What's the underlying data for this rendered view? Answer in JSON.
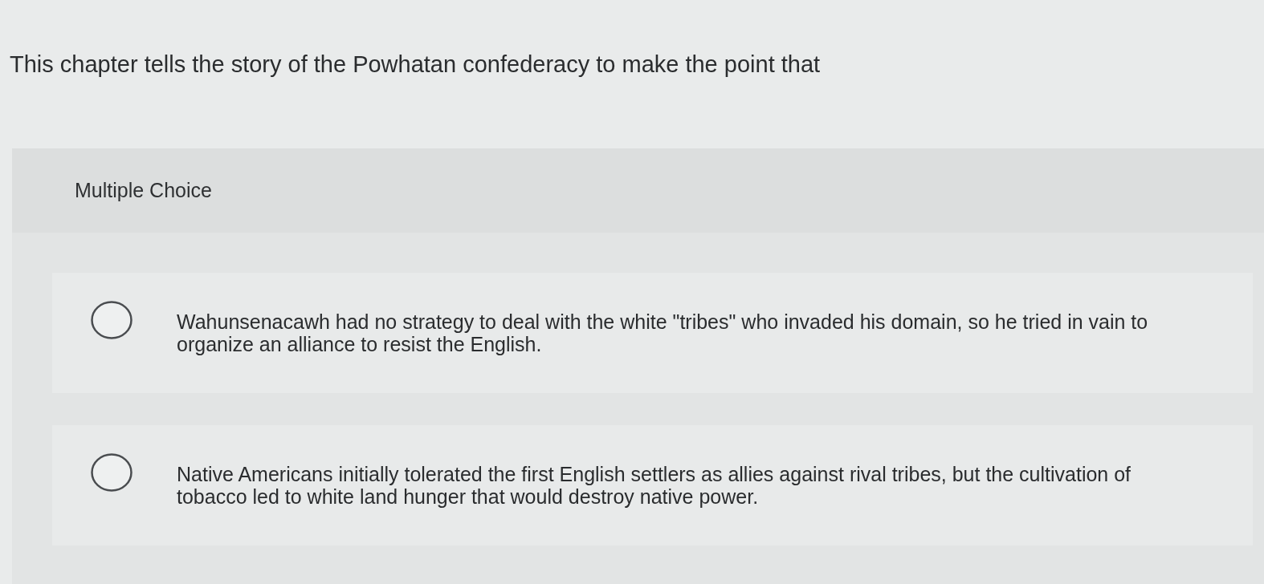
{
  "question": {
    "text": "This chapter tells the story of the Powhatan confederacy to make the point that"
  },
  "panel": {
    "type_label": "Multiple Choice"
  },
  "options": [
    {
      "text": "Wahunsenacawh had no strategy to deal with the white \"tribes\" who invaded his domain, so he tried in vain to organize an alliance to resist the English.",
      "selected": false
    },
    {
      "text": "Native Americans initially tolerated the first English settlers as allies against rival tribes, but the cultivation of tobacco led to white land hunger that would destroy native power.",
      "selected": false
    }
  ]
}
